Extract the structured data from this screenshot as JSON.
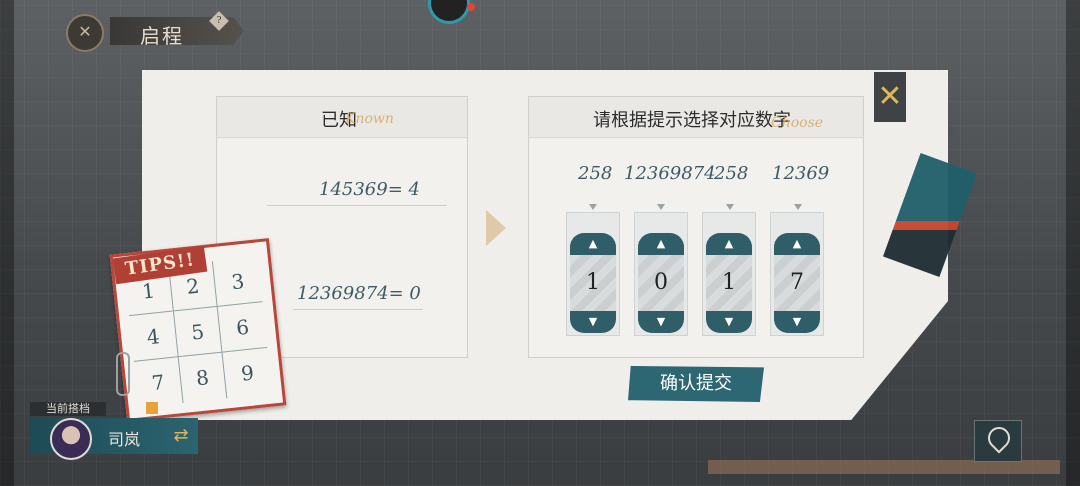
{
  "header": {
    "title": "启程",
    "help_icon": "?"
  },
  "known_panel": {
    "title": "已知",
    "script_word": "Known",
    "equations": [
      "145369= 4",
      "12369874= 0"
    ]
  },
  "choose_panel": {
    "title": "请根据提示选择对应数字",
    "script_word": "Choose",
    "hints": [
      "258",
      "12369874",
      "258",
      "12369"
    ],
    "digits": [
      "1",
      "0",
      "1",
      "7"
    ]
  },
  "confirm_label": "确认提交",
  "tips": {
    "label": "TIPS!!",
    "grid": [
      "1",
      "2",
      "3",
      "4",
      "5",
      "6",
      "7",
      "8",
      "9"
    ]
  },
  "companion": {
    "label": "当前搭档",
    "name": "司岚"
  },
  "colors": {
    "accent_teal": "#2d6773",
    "accent_red": "#b8463a",
    "accent_gold": "#e0b85a"
  }
}
